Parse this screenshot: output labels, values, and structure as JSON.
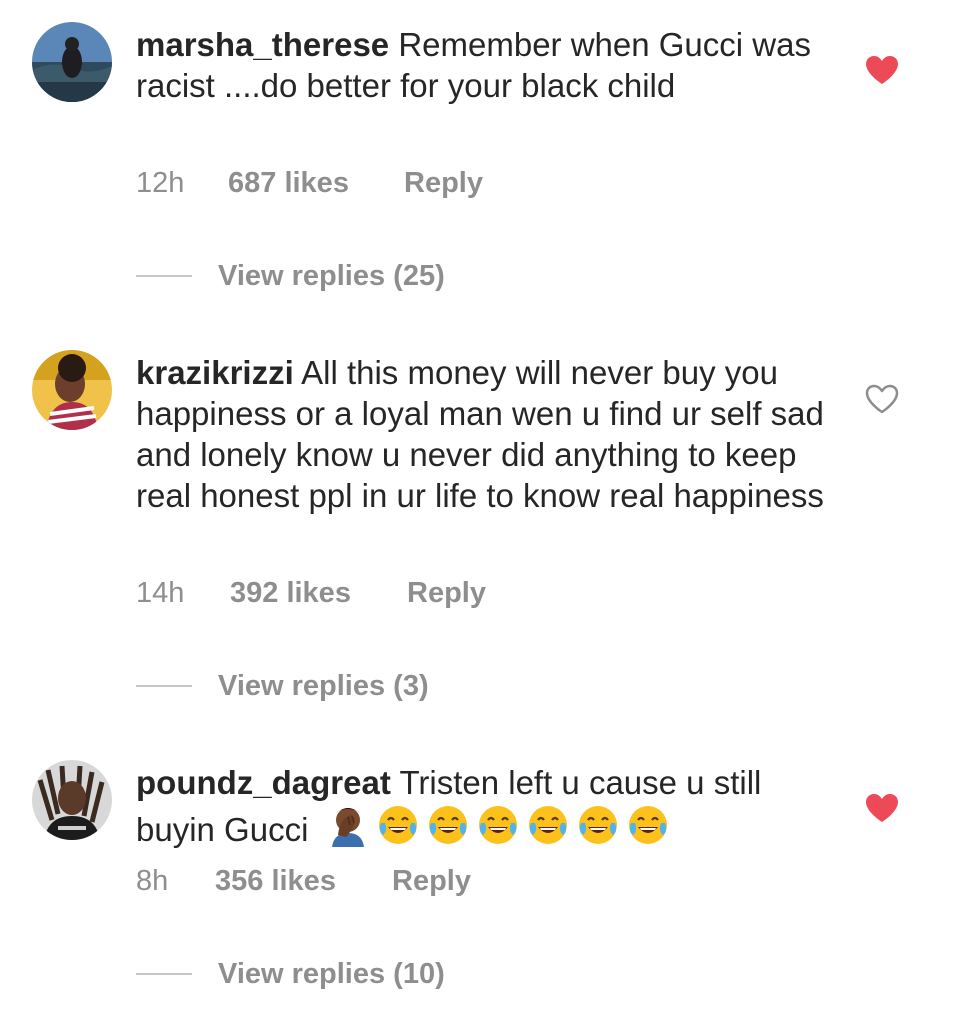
{
  "comments": [
    {
      "username": "marsha_therese",
      "text": "Remember when Gucci was racist ....do better for your black child",
      "time": "12h",
      "likes": "687 likes",
      "reply": "Reply",
      "view_replies": "View replies (25)",
      "liked": true
    },
    {
      "username": "krazikrizzi",
      "text": "All this money will never buy you happiness or a loyal man wen u find ur self sad and lonely know u never did anything to keep real honest ppl in ur life to know real happiness",
      "time": "14h",
      "likes": "392 likes",
      "reply": "Reply",
      "view_replies": "View replies (3)",
      "liked": false
    },
    {
      "username": "poundz_dagreat",
      "text": "Tristen left u cause u still buyin Gucci",
      "emojis": [
        "facepalm-emoji",
        "tears-of-joy-emoji",
        "tears-of-joy-emoji",
        "tears-of-joy-emoji",
        "tears-of-joy-emoji",
        "tears-of-joy-emoji",
        "tears-of-joy-emoji"
      ],
      "time": "8h",
      "likes": "356 likes",
      "reply": "Reply",
      "view_replies": "View replies (10)",
      "liked": true
    }
  ],
  "colors": {
    "text": "#262626",
    "meta": "#8e8e8e",
    "heart_liked": "#ed4956",
    "heart_outline": "#8e8e8e",
    "divider": "#c7c7c7"
  }
}
